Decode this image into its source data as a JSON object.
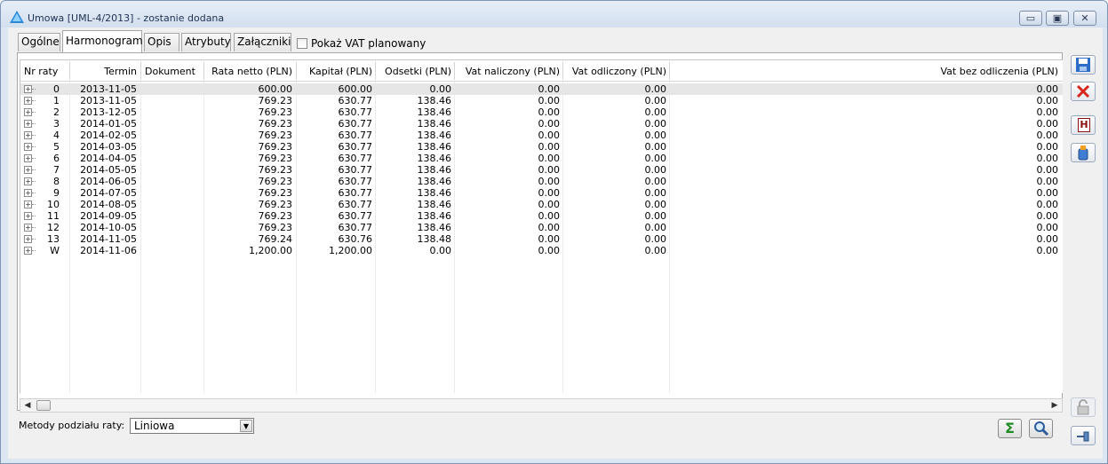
{
  "window": {
    "title": "Umowa [UML-4/2013] - zostanie dodana",
    "minimize_glyph": "▭",
    "maximize_glyph": "▣",
    "close_glyph": "✕"
  },
  "tabs": [
    {
      "label": "Ogólne"
    },
    {
      "label": "Harmonogram",
      "active": true
    },
    {
      "label": "Opis"
    },
    {
      "label": "Atrybuty"
    },
    {
      "label": "Załączniki"
    }
  ],
  "vat_checkbox": {
    "label": "Pokaż VAT planowany",
    "checked": false
  },
  "table": {
    "columns": [
      "Nr raty",
      "Termin",
      "Dokument",
      "Rata netto (PLN)",
      "Kapitał (PLN)",
      "Odsetki (PLN)",
      "Vat naliczony (PLN)",
      "Vat odliczony (PLN)",
      "Vat bez odliczenia (PLN)"
    ],
    "rows": [
      {
        "nr": "0",
        "termin": "2013-11-05",
        "dokument": "",
        "rata": "600.00",
        "kapital": "600.00",
        "odsetki": "0.00",
        "vat_nal": "0.00",
        "vat_odl": "0.00",
        "vat_bez": "0.00"
      },
      {
        "nr": "1",
        "termin": "2013-11-05",
        "dokument": "",
        "rata": "769.23",
        "kapital": "630.77",
        "odsetki": "138.46",
        "vat_nal": "0.00",
        "vat_odl": "0.00",
        "vat_bez": "0.00"
      },
      {
        "nr": "2",
        "termin": "2013-12-05",
        "dokument": "",
        "rata": "769.23",
        "kapital": "630.77",
        "odsetki": "138.46",
        "vat_nal": "0.00",
        "vat_odl": "0.00",
        "vat_bez": "0.00"
      },
      {
        "nr": "3",
        "termin": "2014-01-05",
        "dokument": "",
        "rata": "769.23",
        "kapital": "630.77",
        "odsetki": "138.46",
        "vat_nal": "0.00",
        "vat_odl": "0.00",
        "vat_bez": "0.00"
      },
      {
        "nr": "4",
        "termin": "2014-02-05",
        "dokument": "",
        "rata": "769.23",
        "kapital": "630.77",
        "odsetki": "138.46",
        "vat_nal": "0.00",
        "vat_odl": "0.00",
        "vat_bez": "0.00"
      },
      {
        "nr": "5",
        "termin": "2014-03-05",
        "dokument": "",
        "rata": "769.23",
        "kapital": "630.77",
        "odsetki": "138.46",
        "vat_nal": "0.00",
        "vat_odl": "0.00",
        "vat_bez": "0.00"
      },
      {
        "nr": "6",
        "termin": "2014-04-05",
        "dokument": "",
        "rata": "769.23",
        "kapital": "630.77",
        "odsetki": "138.46",
        "vat_nal": "0.00",
        "vat_odl": "0.00",
        "vat_bez": "0.00"
      },
      {
        "nr": "7",
        "termin": "2014-05-05",
        "dokument": "",
        "rata": "769.23",
        "kapital": "630.77",
        "odsetki": "138.46",
        "vat_nal": "0.00",
        "vat_odl": "0.00",
        "vat_bez": "0.00"
      },
      {
        "nr": "8",
        "termin": "2014-06-05",
        "dokument": "",
        "rata": "769.23",
        "kapital": "630.77",
        "odsetki": "138.46",
        "vat_nal": "0.00",
        "vat_odl": "0.00",
        "vat_bez": "0.00"
      },
      {
        "nr": "9",
        "termin": "2014-07-05",
        "dokument": "",
        "rata": "769.23",
        "kapital": "630.77",
        "odsetki": "138.46",
        "vat_nal": "0.00",
        "vat_odl": "0.00",
        "vat_bez": "0.00"
      },
      {
        "nr": "10",
        "termin": "2014-08-05",
        "dokument": "",
        "rata": "769.23",
        "kapital": "630.77",
        "odsetki": "138.46",
        "vat_nal": "0.00",
        "vat_odl": "0.00",
        "vat_bez": "0.00"
      },
      {
        "nr": "11",
        "termin": "2014-09-05",
        "dokument": "",
        "rata": "769.23",
        "kapital": "630.77",
        "odsetki": "138.46",
        "vat_nal": "0.00",
        "vat_odl": "0.00",
        "vat_bez": "0.00"
      },
      {
        "nr": "12",
        "termin": "2014-10-05",
        "dokument": "",
        "rata": "769.23",
        "kapital": "630.77",
        "odsetki": "138.46",
        "vat_nal": "0.00",
        "vat_odl": "0.00",
        "vat_bez": "0.00"
      },
      {
        "nr": "13",
        "termin": "2014-11-05",
        "dokument": "",
        "rata": "769.24",
        "kapital": "630.76",
        "odsetki": "138.48",
        "vat_nal": "0.00",
        "vat_odl": "0.00",
        "vat_bez": "0.00"
      },
      {
        "nr": "W",
        "termin": "2014-11-06",
        "dokument": "",
        "rata": "1,200.00",
        "kapital": "1,200.00",
        "odsetki": "0.00",
        "vat_nal": "0.00",
        "vat_odl": "0.00",
        "vat_bez": "0.00"
      }
    ]
  },
  "bottom": {
    "method_label": "Metody podziału raty:",
    "method_value": "Liniowa"
  },
  "icons": {
    "sidebar": [
      "save-icon",
      "delete-icon",
      "history-icon",
      "flask-icon",
      "lock-icon",
      "pin-icon"
    ],
    "bottom": [
      "sum-icon",
      "search-icon"
    ],
    "sidebar_letter_h": "H",
    "sum_glyph": "Σ"
  },
  "colors": {
    "title_bg": "#d3dfef",
    "delete_red": "#d9261c",
    "sum_green": "#1f8a22"
  }
}
